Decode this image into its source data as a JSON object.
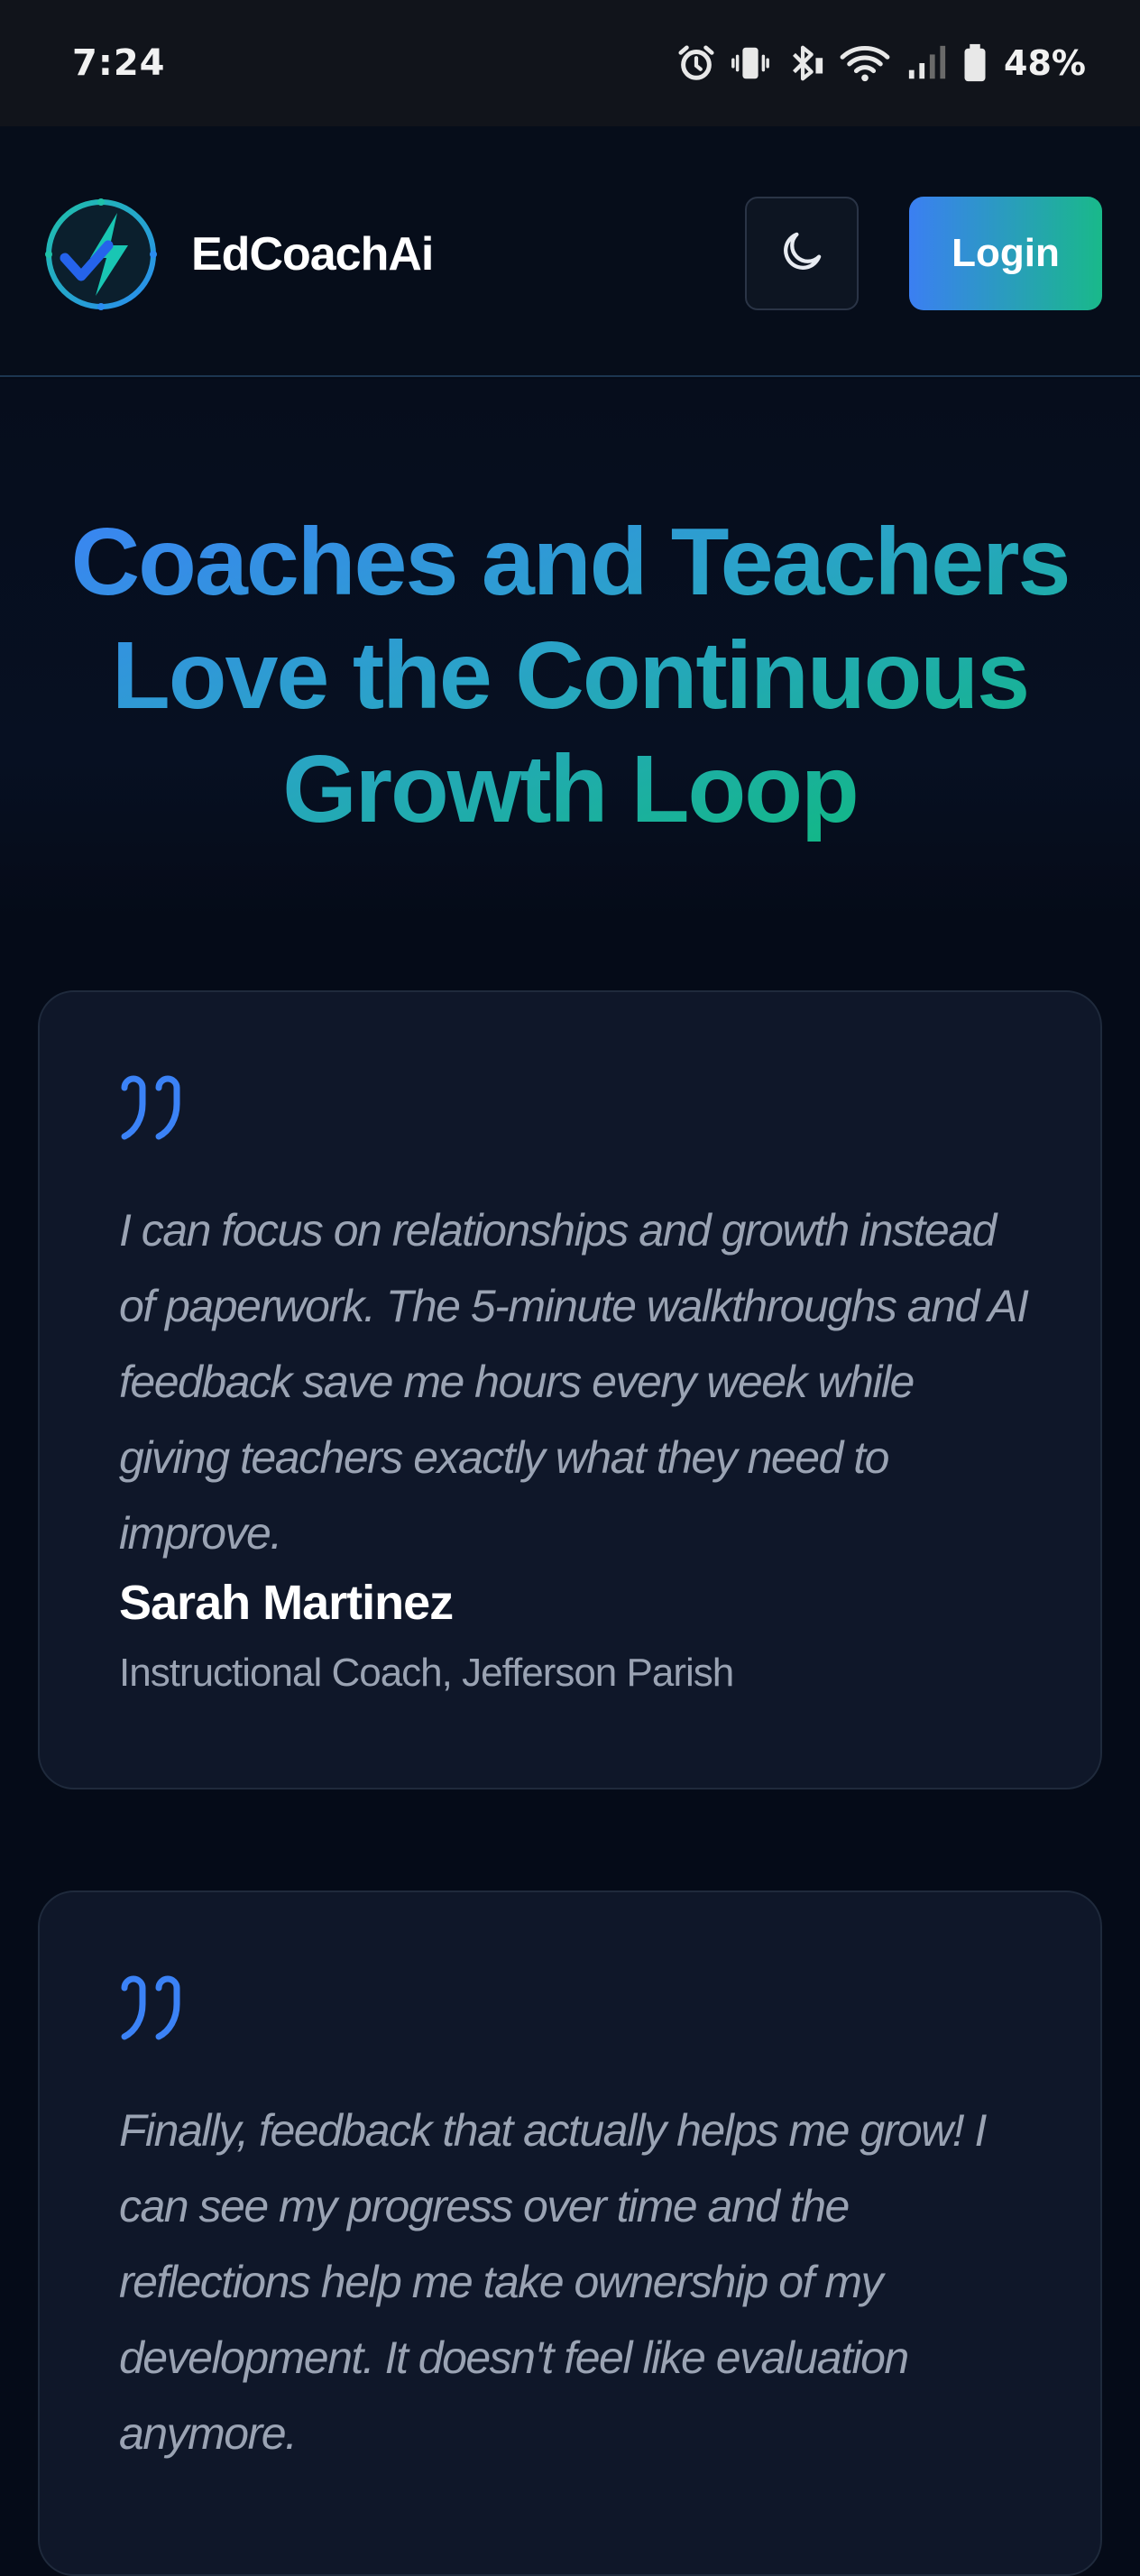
{
  "status_bar": {
    "time": "7:24",
    "battery_percent": "48%",
    "icons": [
      "alarm-icon",
      "vibrate-icon",
      "bluetooth-icon",
      "wifi-icon",
      "signal-icon",
      "battery-icon"
    ]
  },
  "navbar": {
    "brand_name": "EdCoachAi",
    "logo_icon": "lightning-check-logo",
    "theme_toggle_icon": "moon-icon",
    "login_label": "Login",
    "colors": {
      "accent_blue": "#3b82f6",
      "accent_green": "#10b981"
    }
  },
  "hero": {
    "title": "Coaches and Teachers Love the Continuous Growth Loop"
  },
  "testimonials": [
    {
      "quote_icon": "quote-icon",
      "quote": "I can focus on relationships and growth instead of paperwork. The 5-minute walkthroughs and AI feedback save me hours every week while giving teachers exactly what they need to improve.",
      "author": "Sarah Martinez",
      "role": "Instructional Coach, Jefferson Parish"
    },
    {
      "quote_icon": "quote-icon",
      "quote": "Finally, feedback that actually helps me grow! I can see my progress over time and the reflections help me take ownership of my development. It doesn't feel like evaluation anymore."
    }
  ]
}
